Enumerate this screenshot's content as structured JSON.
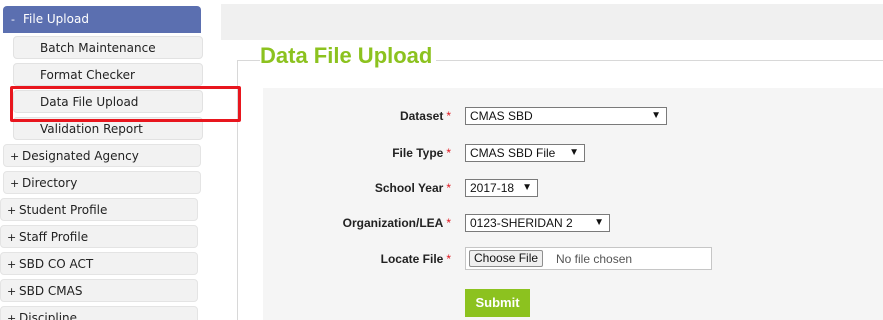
{
  "sidebar": {
    "top_item": {
      "icon": "minus-icon",
      "label": "File Upload"
    },
    "sub_items": [
      {
        "label": "Batch Maintenance"
      },
      {
        "label": "Format Checker"
      },
      {
        "label": "Data File Upload",
        "highlighted": true
      },
      {
        "label": "Validation Report"
      }
    ],
    "main_items": [
      {
        "label": "Designated Agency"
      },
      {
        "label": "Directory"
      },
      {
        "label": "Student Profile"
      },
      {
        "label": "Staff Profile"
      },
      {
        "label": "SBD CO ACT"
      },
      {
        "label": "SBD CMAS"
      },
      {
        "label": "Discipline"
      }
    ],
    "expand_glyph": "+",
    "collapse_glyph": "-"
  },
  "main": {
    "title": "Data File Upload",
    "form": {
      "required_marker": "*",
      "fields": {
        "dataset": {
          "label": "Dataset",
          "value": "CMAS SBD"
        },
        "file_type": {
          "label": "File Type",
          "value": "CMAS SBD File"
        },
        "school_year": {
          "label": "School Year",
          "value": "2017-18"
        },
        "organization": {
          "label": "Organization/LEA",
          "value": "0123-SHERIDAN 2"
        },
        "locate_file": {
          "label": "Locate File",
          "button": "Choose File",
          "status": "No file chosen"
        }
      },
      "submit_label": "Submit",
      "caret": "▼"
    }
  },
  "colors": {
    "title_green": "#8cc21f",
    "sidebar_active": "#5b6fb0",
    "highlight_red": "#e8161e",
    "required_red": "#e0161e"
  }
}
